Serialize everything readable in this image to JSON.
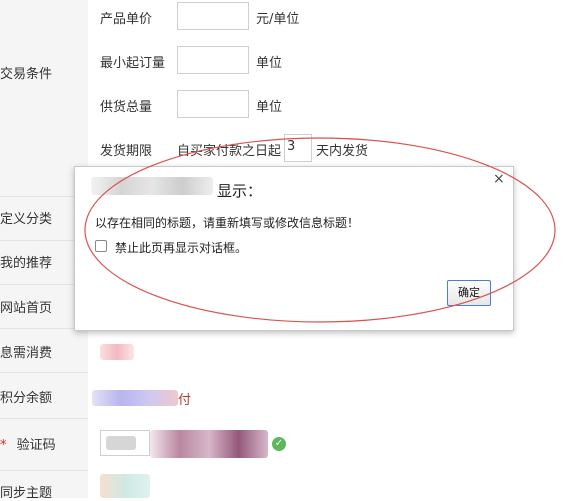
{
  "sidebar": {
    "labels": [
      "交易条件",
      "定义分类",
      "我的推荐",
      "网站首页",
      "息需消费",
      "积分余额",
      "验证码",
      "同步主题"
    ],
    "required_mark": "*"
  },
  "form": {
    "unit_price_label": "产品单价",
    "unit_price_unit": "元/单位",
    "min_order_label": "最小起订量",
    "min_order_unit": "单位",
    "supply_total_label": "供货总量",
    "supply_total_unit": "单位",
    "delivery_label": "发货期限",
    "delivery_prefix": "自买家付款之日起",
    "delivery_days": "3",
    "delivery_suffix": "天内发货",
    "partial_char": "付"
  },
  "dialog": {
    "title_suffix": "显示：",
    "close_symbol": "×",
    "message": "以存在相同的标题，请重新填写或修改信息标题！",
    "checkbox_label": "禁止此页再显示对话框。",
    "ok_label": "确定"
  },
  "colors": {
    "annotation_ellipse": "#d9534f",
    "button_border": "#4a7fc9",
    "verify_ok": "#5cb85c",
    "required": "#e02020"
  }
}
